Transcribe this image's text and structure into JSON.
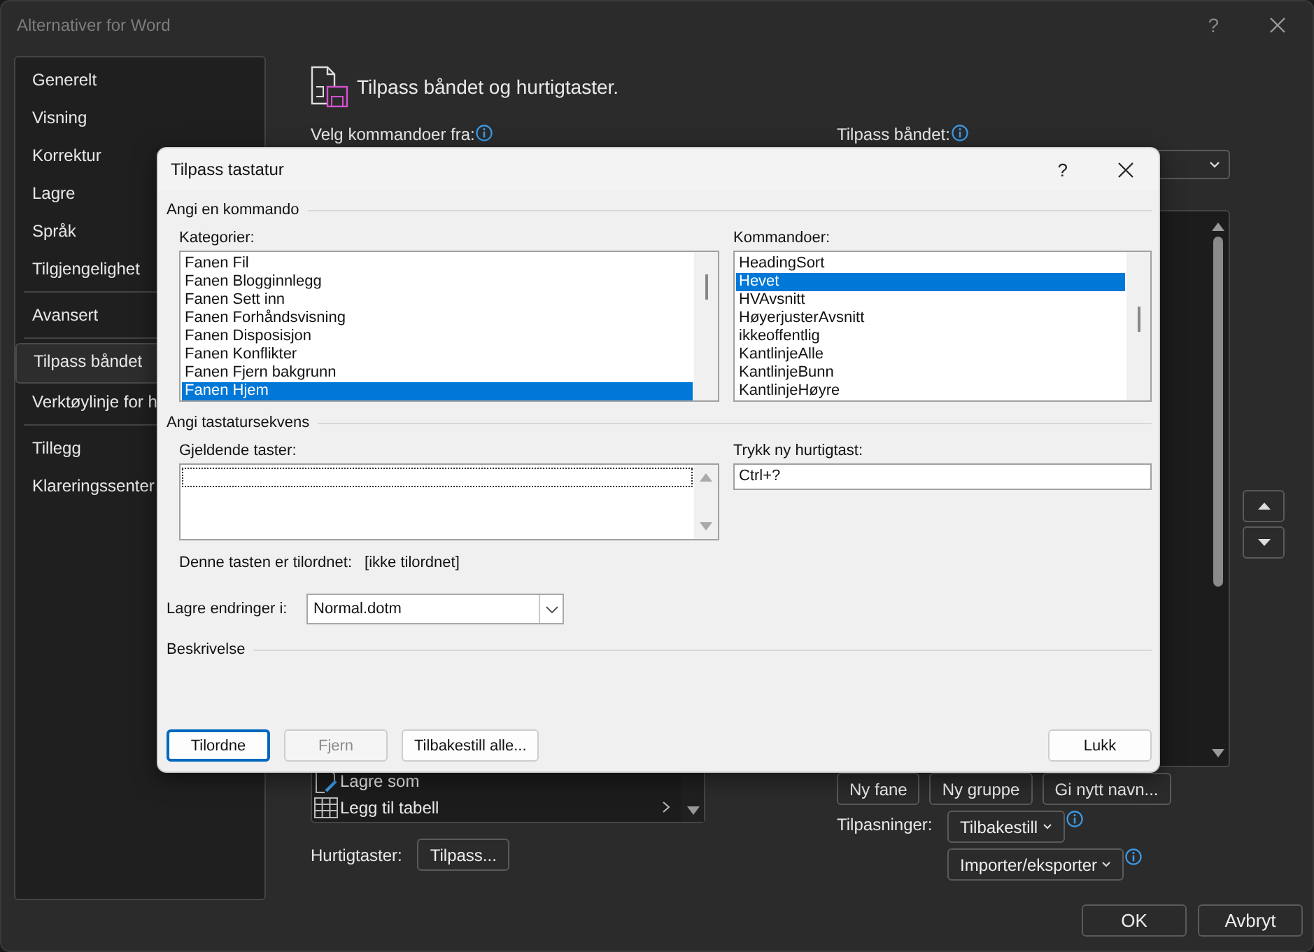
{
  "window": {
    "title": "Alternativer for Word",
    "help": "?"
  },
  "sidebar": {
    "groups": [
      [
        {
          "label": "Generelt",
          "selected": false
        },
        {
          "label": "Visning",
          "selected": false
        },
        {
          "label": "Korrektur",
          "selected": false
        },
        {
          "label": "Lagre",
          "selected": false
        },
        {
          "label": "Språk",
          "selected": false
        },
        {
          "label": "Tilgjengelighet",
          "selected": false
        }
      ],
      [
        {
          "label": "Avansert",
          "selected": false
        }
      ],
      [
        {
          "label": "Tilpass båndet",
          "selected": true
        },
        {
          "label": "Verktøylinje for h",
          "selected": false
        }
      ],
      [
        {
          "label": "Tillegg",
          "selected": false
        },
        {
          "label": "Klareringssenter",
          "selected": false
        }
      ]
    ]
  },
  "main": {
    "heading": "Tilpass båndet og hurtigtaster.",
    "commands_from_label": "Velg kommandoer fra:",
    "ribbon_label": "Tilpass båndet:",
    "commands": [
      {
        "label": "Lagre som",
        "kind": "save-as",
        "submenu": false
      },
      {
        "label": "Legg til tabell",
        "kind": "table",
        "submenu": true
      }
    ],
    "ribbon_buttons": [
      "Ny fane",
      "Ny gruppe",
      "Gi nytt navn..."
    ],
    "customizations_label": "Tilpasninger:",
    "reset_button": "Tilbakestill",
    "import_export_button": "Importer/eksporter",
    "shortcuts_label": "Hurtigtaster:",
    "customize_button": "Tilpass...",
    "ok_button": "OK",
    "cancel_button": "Avbryt"
  },
  "dialog": {
    "title": "Tilpass tastatur",
    "help": "?",
    "command_group": "Angi en kommando",
    "categories_label": "Kategorier:",
    "categories": [
      {
        "label": "Fanen Fil",
        "selected": false
      },
      {
        "label": "Fanen Blogginnlegg",
        "selected": false
      },
      {
        "label": "Fanen Sett inn",
        "selected": false
      },
      {
        "label": "Fanen Forhåndsvisning",
        "selected": false
      },
      {
        "label": "Fanen Disposisjon",
        "selected": false
      },
      {
        "label": "Fanen Konflikter",
        "selected": false
      },
      {
        "label": "Fanen Fjern bakgrunn",
        "selected": false
      },
      {
        "label": "Fanen Hjem",
        "selected": true
      }
    ],
    "commands_label": "Kommandoer:",
    "commands": [
      {
        "label": "HeadingSort",
        "selected": false
      },
      {
        "label": "Hevet",
        "selected": true
      },
      {
        "label": "HVAvsnitt",
        "selected": false
      },
      {
        "label": "HøyerjusterAvsnitt",
        "selected": false
      },
      {
        "label": "ikkeoffentlig",
        "selected": false
      },
      {
        "label": "KantlinjeAlle",
        "selected": false
      },
      {
        "label": "KantlinjeBunn",
        "selected": false
      },
      {
        "label": "KantlinjeHøyre",
        "selected": false
      }
    ],
    "sequence_group": "Angi tastatursekvens",
    "current_keys_label": "Gjeldende taster:",
    "new_key_label": "Trykk ny hurtigtast:",
    "new_key_value": "Ctrl+?",
    "assigned_label": "Denne tasten er tilordnet:",
    "assigned_value": "[ikke tilordnet]",
    "save_label": "Lagre endringer i:",
    "save_value": "Normal.dotm",
    "description_group": "Beskrivelse",
    "buttons": [
      {
        "label": "Tilordne",
        "default": true,
        "disabled": false
      },
      {
        "label": "Fjern",
        "default": false,
        "disabled": true
      },
      {
        "label": "Tilbakestill alle...",
        "default": false,
        "disabled": false
      }
    ],
    "close_button": "Lukk"
  }
}
